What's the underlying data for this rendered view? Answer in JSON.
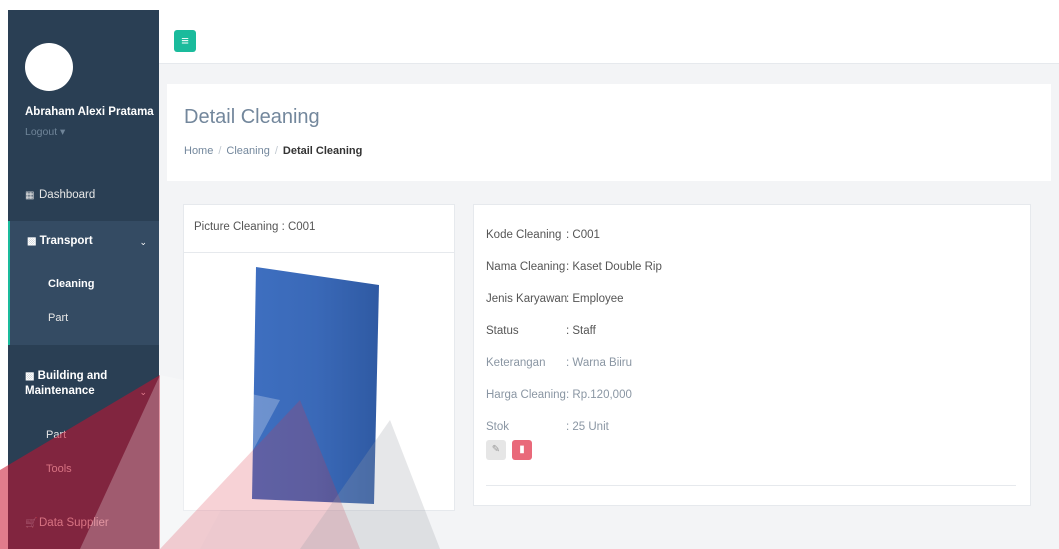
{
  "sidebar": {
    "user_name": "Abraham Alexi Pratama",
    "logout_label": "Logout ▾",
    "dashboard_label": "Dashboard",
    "transport_label": "Transport",
    "transport_items": [
      "Cleaning",
      "Part"
    ],
    "building_label_1": "Building and",
    "building_label_2": "Maintenance",
    "building_items": [
      "Part",
      "Tools"
    ],
    "supplier_label": "Data Supplier"
  },
  "topbar": {
    "menu_icon": "≡"
  },
  "header": {
    "title": "Detail Cleaning",
    "breadcrumb": [
      "Home",
      "Cleaning",
      "Detail Cleaning"
    ],
    "separator": "/"
  },
  "picture_panel": {
    "title": "Picture Cleaning : C001"
  },
  "details": [
    {
      "label": "Kode Cleaning",
      "value": ": C001"
    },
    {
      "label": "Nama Cleaning",
      "value": ": Kaset Double Rip"
    },
    {
      "label": "Jenis Karyawan",
      "value": ": Employee"
    },
    {
      "label": "Status",
      "value": ": Staff"
    },
    {
      "label": "Keterangan",
      "value": ": Warna Biiru"
    },
    {
      "label": "Harga Cleaning",
      "value": ": Rp.120,000"
    },
    {
      "label": "Stok",
      "value": ": 25 Unit"
    }
  ],
  "actions": {
    "edit_icon": "✎",
    "delete_icon": "▮"
  },
  "colors": {
    "accent": "#1abb9c",
    "sidebar": "#2a3f54",
    "danger": "#e9697a"
  }
}
